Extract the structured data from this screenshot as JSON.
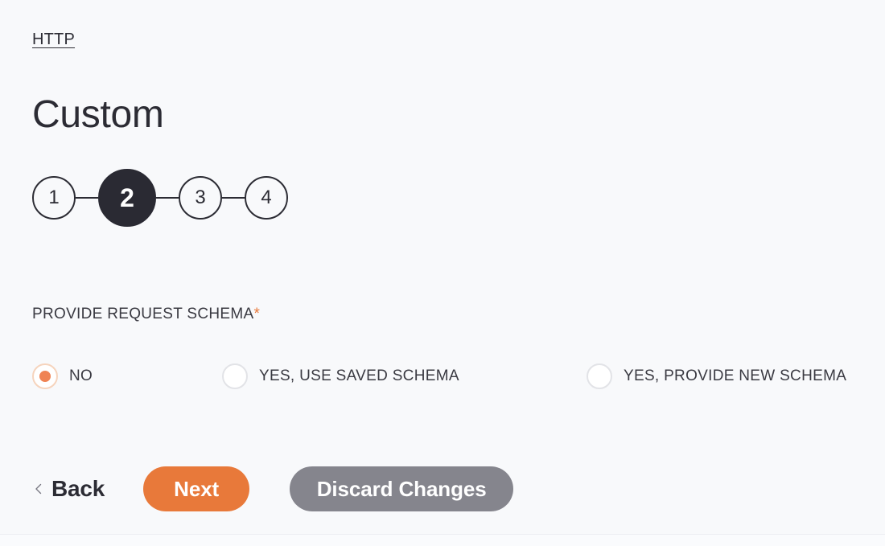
{
  "breadcrumb": {
    "link_label": "HTTP"
  },
  "title": "Custom",
  "stepper": {
    "active_step": 2,
    "steps": [
      {
        "number": "1",
        "state": "inactive"
      },
      {
        "number": "2",
        "state": "active"
      },
      {
        "number": "3",
        "state": "inactive"
      },
      {
        "number": "4",
        "state": "inactive"
      }
    ]
  },
  "form": {
    "field_label": "PROVIDE REQUEST SCHEMA",
    "required_marker": "*",
    "required_color": "#e8793a",
    "selected_value": "NO",
    "options": [
      {
        "label": "NO",
        "selected": true
      },
      {
        "label": "YES, USE SAVED SCHEMA",
        "selected": false
      },
      {
        "label": "YES, PROVIDE NEW SCHEMA",
        "selected": false
      }
    ]
  },
  "actions": {
    "back_label": "Back",
    "back_icon": "chevron-left-icon",
    "next_label": "Next",
    "discard_label": "Discard Changes"
  },
  "colors": {
    "background": "#f8f9fb",
    "text": "#2c2c34",
    "accent_orange": "#e8793a",
    "radio_orange": "#ef8354",
    "step_active": "#2a2a33",
    "secondary_gray": "#85858d"
  }
}
